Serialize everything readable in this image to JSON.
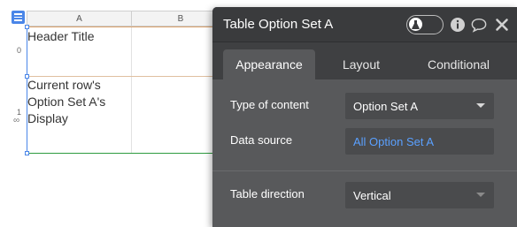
{
  "table": {
    "column_headers": [
      "A",
      "B"
    ],
    "row_numbers": [
      "0",
      "1"
    ],
    "cells": [
      "Header Title",
      "Current row's Option Set A's Display"
    ]
  },
  "panel": {
    "title": "Table Option Set A",
    "tabs": [
      {
        "label": "Appearance",
        "active": true
      },
      {
        "label": "Layout",
        "active": false
      },
      {
        "label": "Conditional",
        "active": false
      }
    ],
    "properties": {
      "type_of_content": {
        "label": "Type of content",
        "value": "Option Set A"
      },
      "data_source": {
        "label": "Data source",
        "value": "All Option Set A"
      },
      "table_direction": {
        "label": "Table direction",
        "value": "Vertical"
      }
    }
  },
  "icons": [
    "menu-icon",
    "link-icon",
    "flask-icon",
    "info-icon",
    "comment-icon",
    "close-icon"
  ],
  "colors": {
    "panel_bg": "#58595b",
    "header_bg": "#3a3b3d",
    "link_blue": "#5aa0ff",
    "selection_blue": "#4a86e8",
    "accent_orange": "#d9a06b"
  }
}
